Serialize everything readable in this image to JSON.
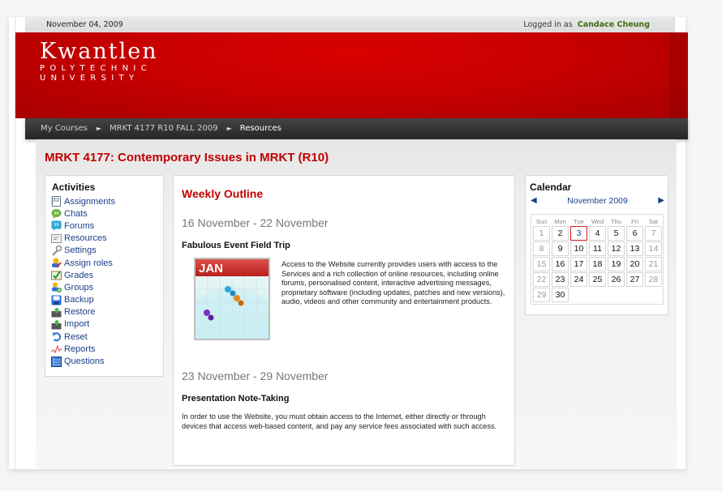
{
  "header": {
    "date": "November 04, 2009",
    "logged_in_label": "Logged in as",
    "user_name": "Candace Cheung"
  },
  "logo": {
    "name": "Kwantlen",
    "line2": "POLYTECHNIC",
    "line3": "UNIVERSITY"
  },
  "breadcrumb": {
    "items": [
      "My Courses",
      "MRKT 4177 R10 FALL 2009",
      "Resources"
    ],
    "separator": "►"
  },
  "course": {
    "title": "MRKT 4177: Contemporary Issues in MRKT (R10)"
  },
  "activities": {
    "title": "Activities",
    "items": [
      {
        "label": "Assignments",
        "icon": "assignment-icon"
      },
      {
        "label": "Chats",
        "icon": "chat-icon"
      },
      {
        "label": "Forums",
        "icon": "forum-icon"
      },
      {
        "label": "Resources",
        "icon": "resource-icon"
      },
      {
        "label": "Settings",
        "icon": "wrench-icon"
      },
      {
        "label": "Assign roles",
        "icon": "assign-roles-icon"
      },
      {
        "label": "Grades",
        "icon": "grades-icon"
      },
      {
        "label": "Groups",
        "icon": "groups-icon"
      },
      {
        "label": "Backup",
        "icon": "floppy-disk-icon"
      },
      {
        "label": "Restore",
        "icon": "restore-icon"
      },
      {
        "label": "Import",
        "icon": "import-icon"
      },
      {
        "label": "Reset",
        "icon": "reset-icon"
      },
      {
        "label": "Reports",
        "icon": "reports-icon"
      },
      {
        "label": "Questions",
        "icon": "questions-icon"
      }
    ]
  },
  "outline": {
    "title": "Weekly Outline",
    "weeks": [
      {
        "range": "16 November - 22 November",
        "topic": "Fabulous Event Field Trip",
        "image_label": "JAN",
        "text": "Access to the Website currently provides users with access to the Services and a rich collection of online resources, including online forums, personalised content, interactive advertising messages, proprietary software (including updates, patches and new versions), audio, videos and other community and entertainment products."
      },
      {
        "range": "23 November - 29 November",
        "topic": "Presentation Note-Taking",
        "text": "In order to use the Website, you must obtain access to the Internet, either directly or through devices that access web-based content, and pay any service fees associated with such access."
      }
    ]
  },
  "calendar": {
    "title": "Calendar",
    "month": "November 2009",
    "prev_icon": "◀",
    "next_icon": "▶",
    "weekdays": [
      "Sun",
      "Mon",
      "Tue",
      "Wed",
      "Thu",
      "Fri",
      "Sat"
    ],
    "days": [
      "1",
      "2",
      "3",
      "4",
      "5",
      "6",
      "7",
      "8",
      "9",
      "10",
      "11",
      "12",
      "13",
      "14",
      "15",
      "16",
      "17",
      "18",
      "19",
      "20",
      "21",
      "22",
      "23",
      "24",
      "25",
      "26",
      "27",
      "28",
      "29",
      "30"
    ],
    "today": "3",
    "colors": {
      "today_border": "#d61b1b",
      "link": "#1a3f8a"
    }
  },
  "colors": {
    "brand_red": "#c80000",
    "title_red": "#c10000",
    "user_green": "#3f6b10",
    "link_blue": "#1a3f8a"
  }
}
